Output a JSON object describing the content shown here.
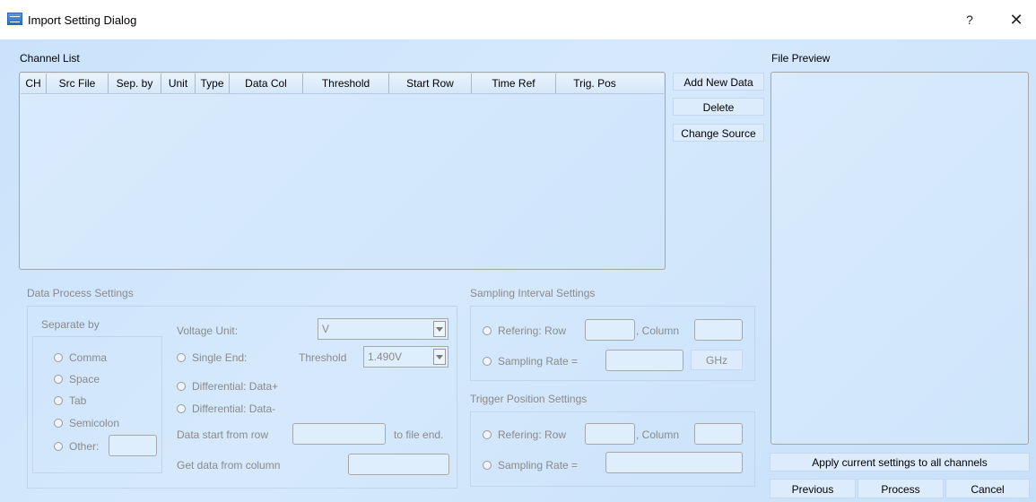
{
  "window": {
    "title": "Import Setting Dialog",
    "help": "?",
    "close": "✕"
  },
  "channel_list": {
    "label": "Channel List",
    "columns": [
      "CH",
      "Src File",
      "Sep. by",
      "Unit",
      "Type",
      "Data Col",
      "Threshold",
      "Start Row",
      "Time Ref",
      "Trig. Pos"
    ]
  },
  "side_buttons": {
    "add": "Add New Data",
    "delete": "Delete",
    "change_source": "Change Source"
  },
  "file_preview": {
    "label": "File Preview",
    "apply_all": "Apply current settings to all channels"
  },
  "data_process": {
    "title": "Data Process Settings",
    "separate_by": "Separate by",
    "separators": [
      "Comma",
      "Space",
      "Tab",
      "Semicolon",
      "Other:"
    ],
    "voltage_unit_label": "Voltage Unit:",
    "voltage_unit_value": "V",
    "single_end": "Single End:",
    "threshold_label": "Threshold",
    "threshold_value": "1.490V",
    "diff_plus": "Differential: Data+",
    "diff_minus": "Differential: Data-",
    "start_row_label": "Data start from row",
    "to_file_end": "to file end.",
    "get_column_label": "Get data from column"
  },
  "sampling_interval": {
    "title": "Sampling Interval Settings",
    "refering_row": "Refering: Row",
    "column": ", Column",
    "sampling_rate": "Sampling Rate =",
    "unit": "GHz"
  },
  "trigger_position": {
    "title": "Trigger Position Settings",
    "refering_row": "Refering: Row",
    "column": ", Column",
    "sampling_rate": "Sampling Rate ="
  },
  "footer": {
    "previous": "Previous",
    "process": "Process",
    "cancel": "Cancel"
  }
}
